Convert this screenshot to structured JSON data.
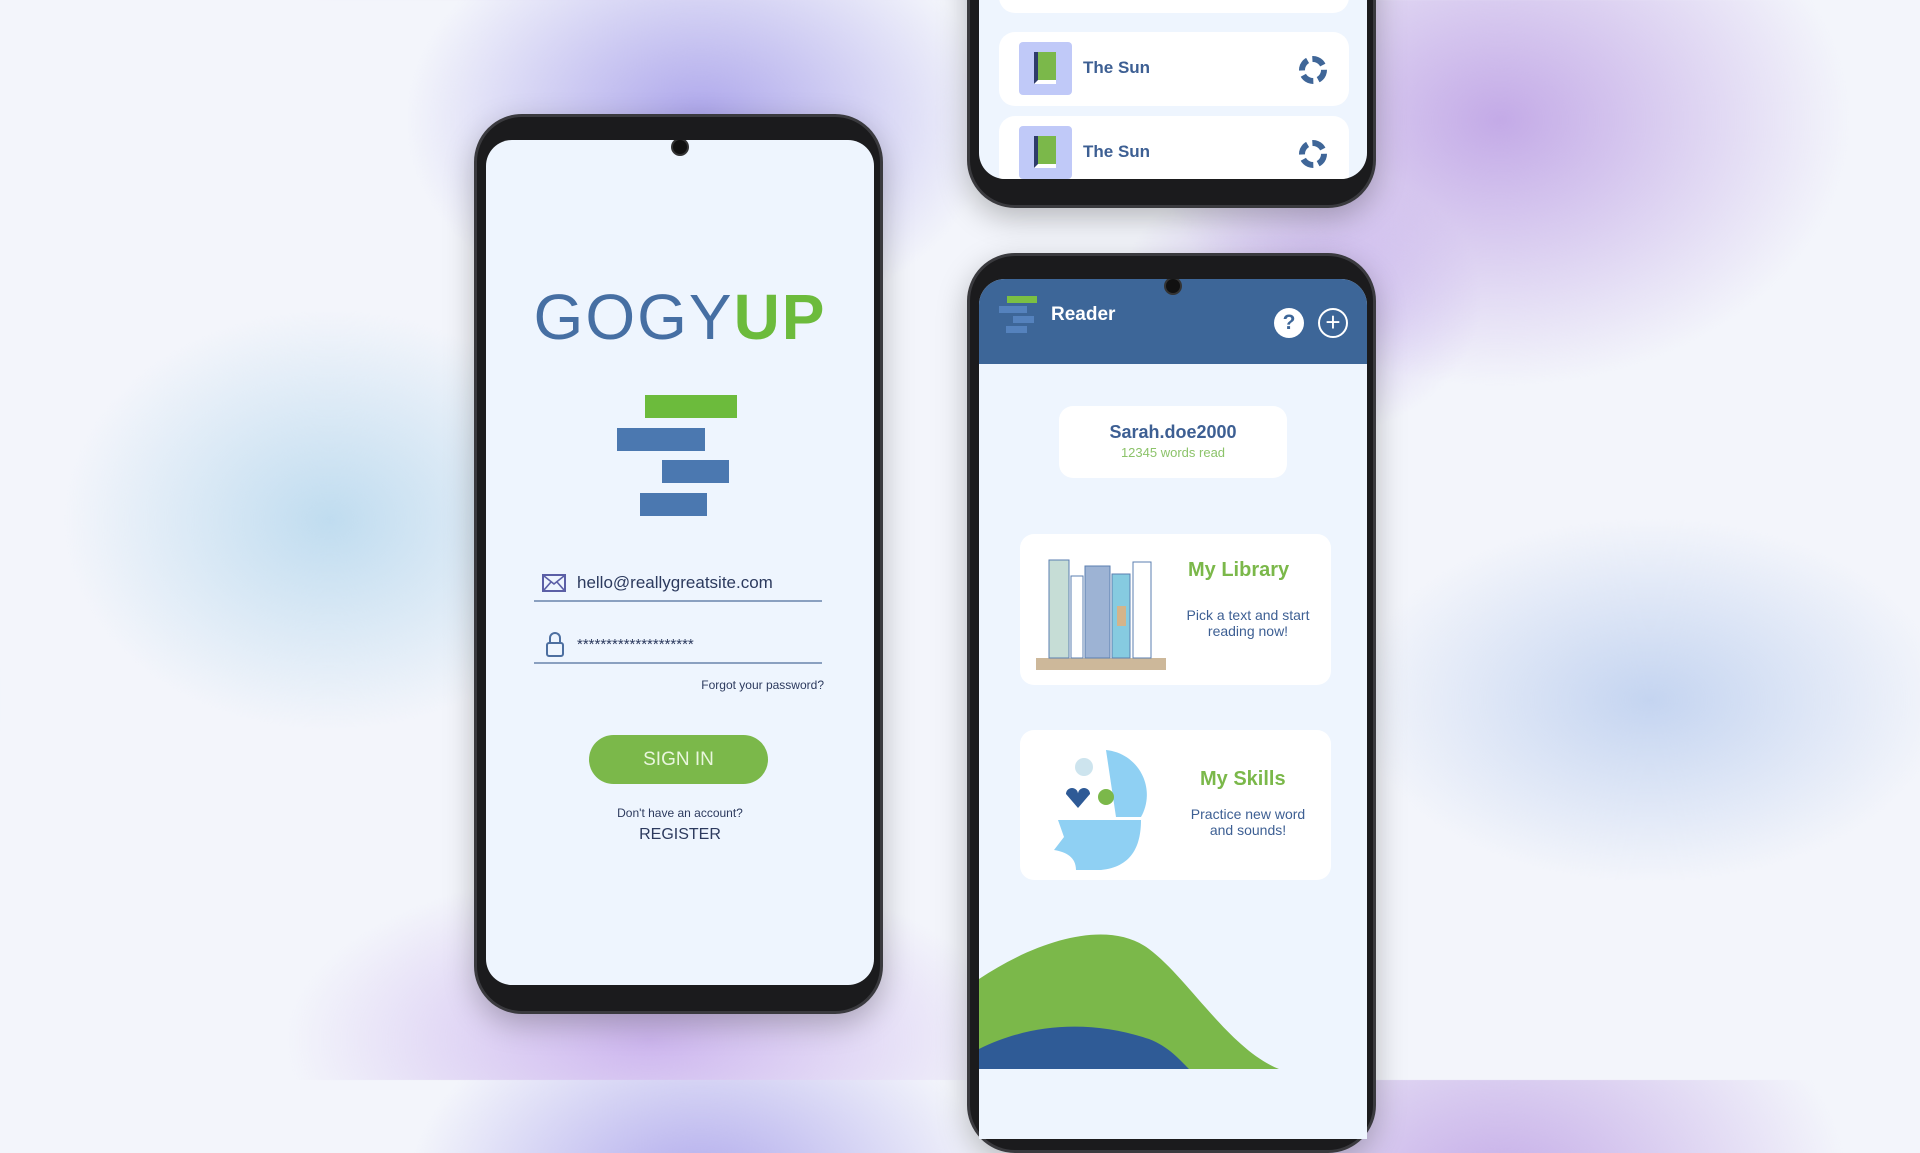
{
  "login": {
    "logo_part1": "GOGY",
    "logo_part2": "UP",
    "email": "hello@reallygreatsite.com",
    "password": "********************",
    "forgot": "Forgot your password?",
    "sign_in": "SIGN IN",
    "no_account": "Don't have an account?",
    "register": "REGISTER"
  },
  "list": {
    "items": [
      {
        "title": "The Sun"
      },
      {
        "title": "The Sun"
      }
    ]
  },
  "home": {
    "title": "Reader",
    "username": "Sarah.doe2000",
    "words_read": "12345 words read",
    "library": {
      "title": "My Library",
      "desc": "Pick a  text and start  reading now!"
    },
    "skills": {
      "title": "My Skills",
      "desc": "Practice new word and sounds!"
    }
  },
  "colors": {
    "blue": "#3f6698",
    "green": "#7bb84a",
    "bg": "#eef5fe"
  }
}
